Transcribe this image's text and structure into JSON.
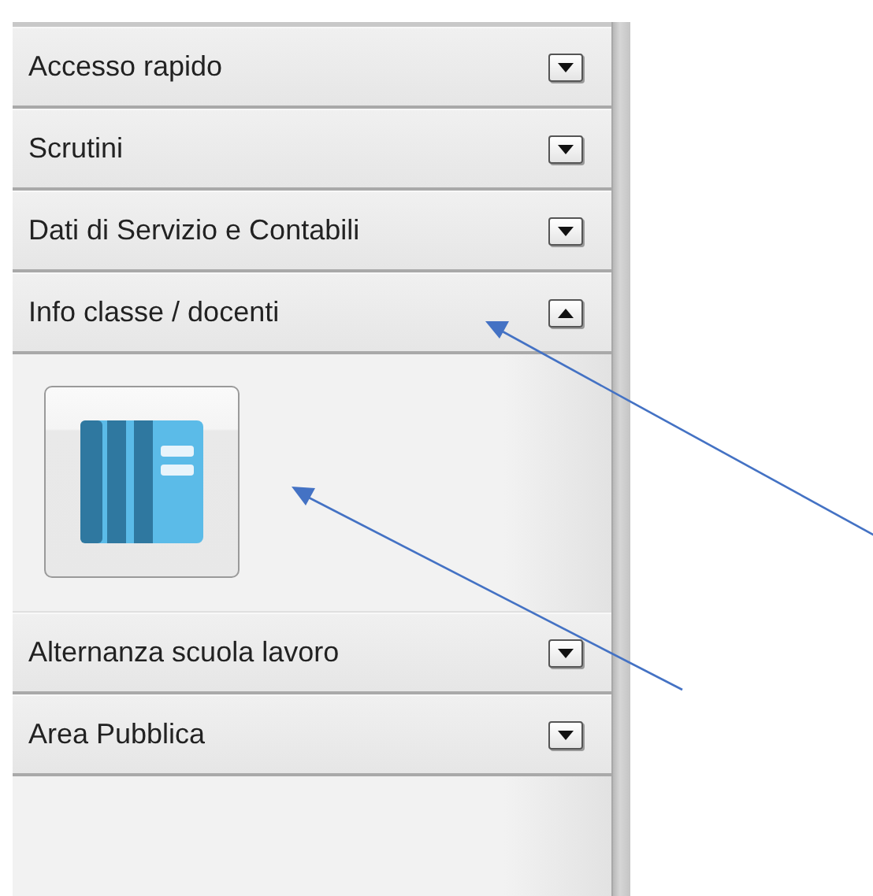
{
  "sections": [
    {
      "title": "Accesso rapido",
      "expanded": false
    },
    {
      "title": "Scrutini",
      "expanded": false
    },
    {
      "title": "Dati di Servizio e Contabili",
      "expanded": false
    },
    {
      "title": "Info classe / docenti",
      "expanded": true
    },
    {
      "title": "Alternanza scuola lavoro",
      "expanded": false
    },
    {
      "title": "Area Pubblica",
      "expanded": false
    }
  ]
}
